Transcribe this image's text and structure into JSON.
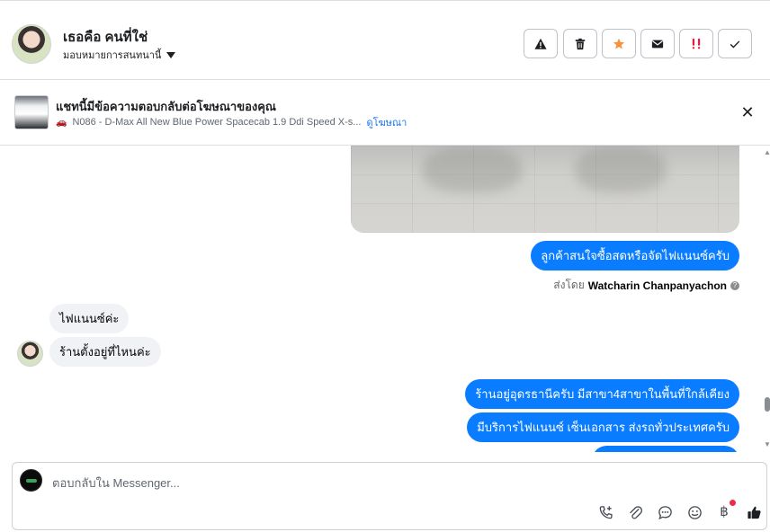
{
  "header": {
    "name": "เธอคือ คนที่ใช่",
    "assign_label": "มอบหมายการสนทนานี้",
    "actions": [
      {
        "name": "spam-button",
        "icon": "warning-icon"
      },
      {
        "name": "delete-button",
        "icon": "trash-icon"
      },
      {
        "name": "star-button",
        "icon": "star-icon",
        "color": "#f7923b"
      },
      {
        "name": "mark-unread-button",
        "icon": "envelope-icon"
      },
      {
        "name": "follow-up-button",
        "icon": "exclamation-icon",
        "color": "#e41e3f"
      },
      {
        "name": "mark-done-button",
        "icon": "check-icon"
      }
    ]
  },
  "banner": {
    "title": "แชทนี้มีข้อความตอบกลับต่อโฆษณาของคุณ",
    "ad_text": "N086 - D-Max All New Blue Power Spacecab 1.9 Ddi Speed X-s...",
    "ad_link": "ดูโฆษณา"
  },
  "messages": {
    "m1": "ลูกค้าสนใจซื้อสดหรือจัดไฟแนนซ์ครับ",
    "sent_by_prefix": "ส่งโดย",
    "sent_by_name": "Watcharin Chanpanyachon",
    "m2": "ไฟแนนซ์ค่ะ",
    "m3": "ร้านตั้งอยู่ที่ไหนค่ะ",
    "m4": "ร้านอยู่อุดรธานีครับ มีสาขา4สาขาในพื้นที่ใกล้เคียง",
    "m5": "มีบริการไฟแนนซ์ เซ็นเอกสาร ส่งรถทั่วประเทศครับ"
  },
  "composer": {
    "placeholder": "ตอบกลับใน Messenger...",
    "baht_symbol": "฿"
  },
  "colors": {
    "outgoing_bubble": "#0a7cff",
    "incoming_bubble": "#f0f2f5",
    "link": "#1877f2"
  }
}
